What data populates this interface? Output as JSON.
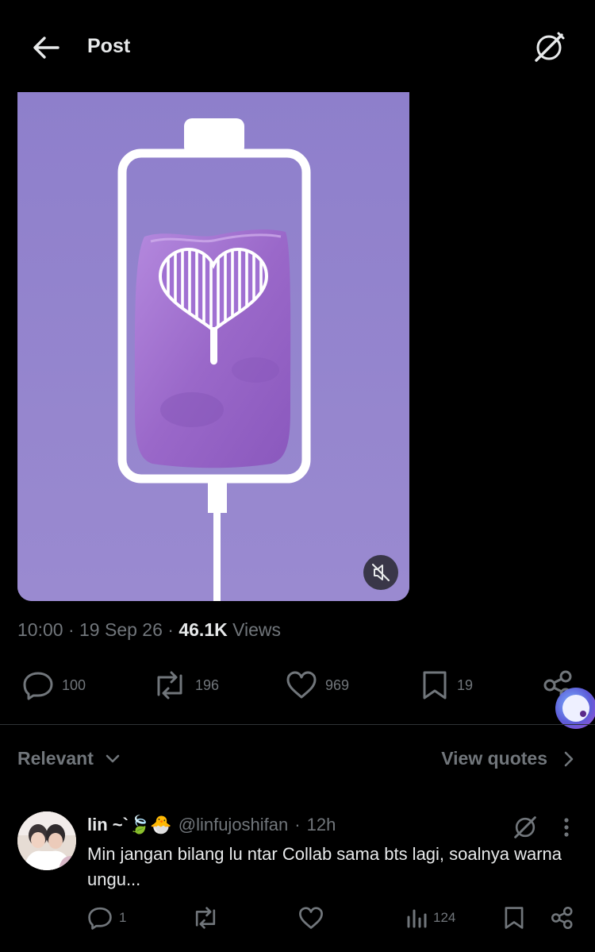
{
  "header": {
    "title": "Post",
    "back_icon": "arrow-left-icon",
    "grok_icon": "grok-icon"
  },
  "media": {
    "type": "video",
    "background_color": "#8f7ec9",
    "mute_icon": "speaker-muted-icon"
  },
  "post_meta": {
    "time": "10:00",
    "date": "19 Sep 26",
    "views_count": "46.1K",
    "views_label": "Views",
    "separator": "·"
  },
  "actions": {
    "reply_count": "100",
    "repost_count": "196",
    "like_count": "969",
    "bookmark_count": "19"
  },
  "sort": {
    "label": "Relevant"
  },
  "quotes": {
    "label": "View quotes"
  },
  "reply": {
    "name": "lin ~`🍃🐣",
    "handle": "@linfujoshifan",
    "time": "12h",
    "separator": "·",
    "text": "Min jangan bilang lu ntar Collab sama bts lagi, soalnya warna ungu...",
    "reply_count": "1",
    "repost_count": "",
    "like_count": "",
    "views_count": "124"
  },
  "colors": {
    "background": "#000000",
    "text_primary": "#e7e9ea",
    "text_secondary": "#71767b",
    "accent_purple": "#8f7ec9"
  }
}
